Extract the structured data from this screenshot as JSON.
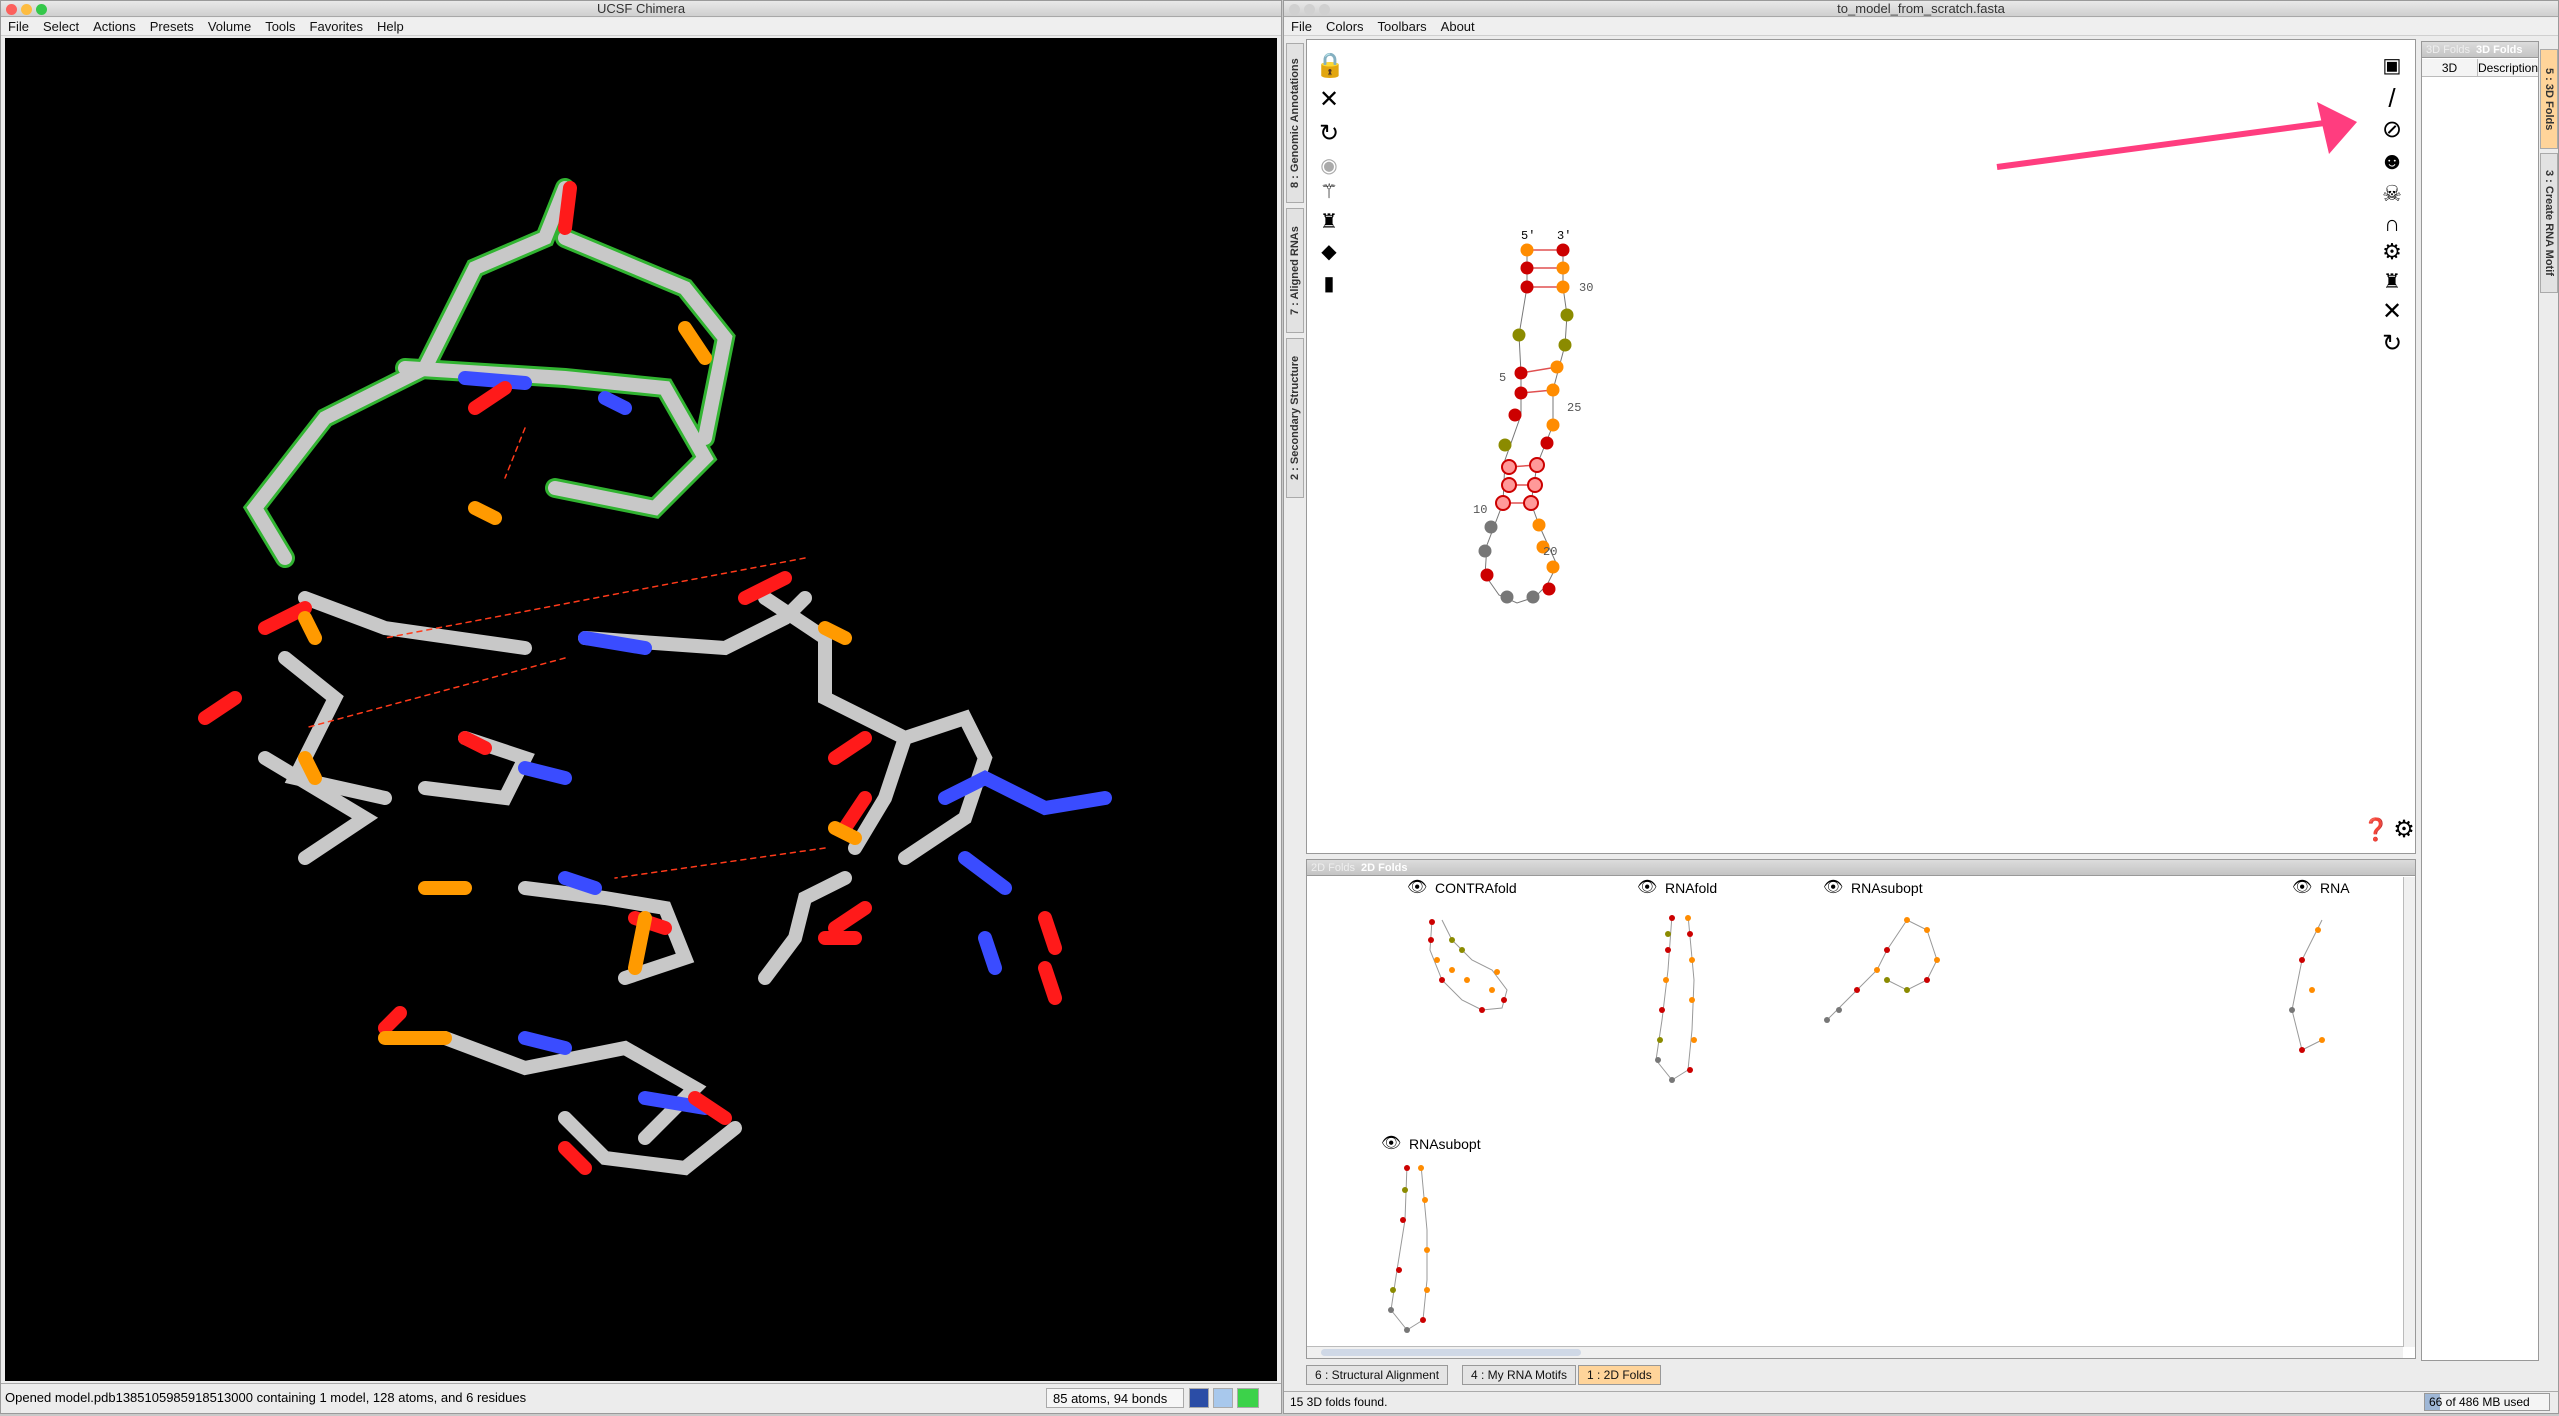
{
  "chimera": {
    "title": "UCSF Chimera",
    "menu": [
      "File",
      "Select",
      "Actions",
      "Presets",
      "Volume",
      "Tools",
      "Favorites",
      "Help"
    ],
    "status_text": "Opened model.pdb1385105985918513000 containing 1 model, 128 atoms, and 6 residues",
    "atoms_bonds": "85 atoms, 94 bonds"
  },
  "assemble": {
    "title": "to_model_from_scratch.fasta",
    "menu": [
      "File",
      "Colors",
      "Toolbars",
      "About"
    ],
    "left_tabs": [
      "8 : Genomic Annotations",
      "7 : Aligned RNAs",
      "2 : Secondary Structure"
    ],
    "right_tabs": [
      "5 : 3D Folds",
      "3 : Create RNA Motif"
    ],
    "structure_labels": {
      "five": "5'",
      "three": "3'",
      "n30": "30",
      "n5": "5",
      "n25": "25",
      "n10": "10",
      "n20": "20"
    },
    "folds3d": {
      "header_left": "3D Folds",
      "header_title": "3D Folds",
      "col_3d": "3D",
      "col_desc": "Description"
    },
    "folds2d": {
      "header_left": "2D Folds",
      "header_title": "2D Folds",
      "labels": [
        "CONTRAfold",
        "RNAfold",
        "RNAsubopt",
        "RNA",
        "RNAsubopt"
      ]
    },
    "bottom_tabs": [
      "6 : Structural Alignment",
      "4 : My RNA Motifs",
      "1 : 2D Folds"
    ],
    "status_text": "15 3D folds found.",
    "memory": "66 of 486 MB used"
  },
  "colors": {
    "accent_tab": "#ffd49a",
    "arrow": "#ff3d7f"
  }
}
